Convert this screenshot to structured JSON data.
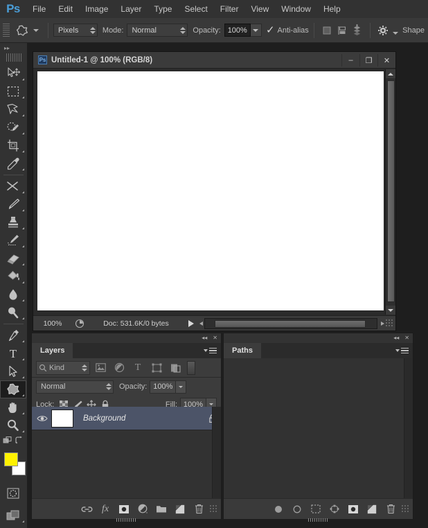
{
  "app": {
    "logo": "Ps",
    "accent_blue": "#4a9ed8",
    "chrome_bg": "#323232",
    "panel_bg": "#2e2e2e",
    "selected_layer_bg": "#4c5468",
    "foreground_color": "#FFF200",
    "background_color": "#FFFFFF"
  },
  "menubar": {
    "items": [
      {
        "label": "File"
      },
      {
        "label": "Edit"
      },
      {
        "label": "Image"
      },
      {
        "label": "Layer"
      },
      {
        "label": "Type"
      },
      {
        "label": "Select"
      },
      {
        "label": "Filter"
      },
      {
        "label": "View"
      },
      {
        "label": "Window"
      },
      {
        "label": "Help"
      }
    ]
  },
  "options_bar": {
    "tool_icon": "custom-shape-tool-icon",
    "draw_mode": {
      "label": "",
      "value": "Pixels"
    },
    "mode": {
      "label": "Mode:",
      "value": "Normal"
    },
    "opacity": {
      "label": "Opacity:",
      "value": "100%"
    },
    "antialias": {
      "label": "Anti-alias",
      "checked": true
    },
    "align_icon": "align-shape-icon",
    "arrange_icon": "arrange-shape-icon",
    "merge_icon": "merge-shapes-icon",
    "gear_icon": "gear-icon",
    "shape_label": "Shape"
  },
  "toolbar": {
    "collapse_label": "▸▸",
    "tools": [
      {
        "name": "move-tool",
        "glyph": "move"
      },
      {
        "name": "rectangular-marquee-tool",
        "glyph": "marquee"
      },
      {
        "name": "lasso-tool",
        "glyph": "lasso"
      },
      {
        "name": "quick-selection-tool",
        "glyph": "quickselect"
      },
      {
        "name": "crop-tool",
        "glyph": "crop"
      },
      {
        "name": "eyedropper-tool",
        "glyph": "eyedropper"
      },
      {
        "name": "spot-healing-brush-tool",
        "glyph": "heal"
      },
      {
        "name": "brush-tool",
        "glyph": "brush"
      },
      {
        "name": "clone-stamp-tool",
        "glyph": "stamp"
      },
      {
        "name": "history-brush-tool",
        "glyph": "historybrush"
      },
      {
        "name": "eraser-tool",
        "glyph": "eraser"
      },
      {
        "name": "gradient-tool",
        "glyph": "paintbucket"
      },
      {
        "name": "blur-tool",
        "glyph": "blur"
      },
      {
        "name": "dodge-tool",
        "glyph": "dodge"
      },
      {
        "name": "pen-tool",
        "glyph": "pen"
      },
      {
        "name": "type-tool",
        "glyph": "type"
      },
      {
        "name": "path-selection-tool",
        "glyph": "pathselect"
      },
      {
        "name": "custom-shape-tool",
        "glyph": "customshape",
        "selected": true
      },
      {
        "name": "hand-tool",
        "glyph": "hand"
      },
      {
        "name": "zoom-tool",
        "glyph": "zoom"
      }
    ],
    "edit_toolbar": {
      "name": "edit-toolbar-icon"
    },
    "swap_colors": {
      "name": "swap-colors-icon"
    },
    "default_colors": {
      "name": "default-colors-icon"
    },
    "quick_mask": {
      "name": "quick-mask-icon"
    },
    "screen_mode": {
      "name": "screen-mode-icon"
    }
  },
  "document": {
    "badge": "Ps",
    "title": "Untitled-1 @ 100% (RGB/8)",
    "window_buttons": [
      {
        "name": "minimize-button",
        "glyph": "–"
      },
      {
        "name": "maximize-button",
        "glyph": "❐"
      },
      {
        "name": "close-button",
        "glyph": "✕"
      }
    ],
    "status": {
      "zoom": "100%",
      "doc_info": "Doc: 531.6K/0 bytes",
      "proxy_icon": "proxy-preview-icon",
      "play_icon": "status-play-icon"
    }
  },
  "layers_panel": {
    "collapse_icon": "collapse-panel-icon",
    "close_icon": "close-panel-icon",
    "tabs": [
      {
        "label": "Layers",
        "active": true
      }
    ],
    "menu_icon": "panel-menu-icon",
    "filter": {
      "search_icon": "search-icon",
      "kind_label": "Kind",
      "icons": [
        {
          "name": "filter-pixel-layers-icon"
        },
        {
          "name": "filter-adjustment-layers-icon"
        },
        {
          "name": "filter-type-layers-icon"
        },
        {
          "name": "filter-shape-layers-icon"
        },
        {
          "name": "filter-smart-object-layers-icon"
        }
      ],
      "toggle_name": "filter-toggle-switch"
    },
    "blend_mode": {
      "value": "Normal"
    },
    "opacity": {
      "label": "Opacity:",
      "value": "100%"
    },
    "lock": {
      "label": "Lock:",
      "icons": [
        {
          "name": "lock-transparent-pixels-icon"
        },
        {
          "name": "lock-image-pixels-icon"
        },
        {
          "name": "lock-position-icon"
        },
        {
          "name": "lock-all-icon"
        }
      ]
    },
    "fill": {
      "label": "Fill:",
      "value": "100%"
    },
    "layers": [
      {
        "name": "Background",
        "visible": true,
        "locked": true,
        "selected": true,
        "thumbnail_color": "#FFFFFF"
      }
    ],
    "footer_buttons": [
      {
        "name": "link-layers-button",
        "glyph": "link"
      },
      {
        "name": "layer-style-button",
        "glyph": "fx"
      },
      {
        "name": "add-layer-mask-button",
        "glyph": "mask"
      },
      {
        "name": "new-adjustment-layer-button",
        "glyph": "adjust"
      },
      {
        "name": "new-group-button",
        "glyph": "folder"
      },
      {
        "name": "new-layer-button",
        "glyph": "newlayer"
      },
      {
        "name": "delete-layer-button",
        "glyph": "trash"
      }
    ]
  },
  "paths_panel": {
    "collapse_icon": "collapse-panel-icon",
    "close_icon": "close-panel-icon",
    "tabs": [
      {
        "label": "Paths",
        "active": true
      }
    ],
    "menu_icon": "panel-menu-icon",
    "paths": [],
    "footer_buttons": [
      {
        "name": "fill-path-button",
        "glyph": "fillpath"
      },
      {
        "name": "stroke-path-button",
        "glyph": "strokepath"
      },
      {
        "name": "load-path-as-selection-button",
        "glyph": "pathselection"
      },
      {
        "name": "make-work-path-button",
        "glyph": "makepath"
      },
      {
        "name": "add-layer-mask-button",
        "glyph": "mask"
      },
      {
        "name": "new-path-button",
        "glyph": "newlayer"
      },
      {
        "name": "delete-path-button",
        "glyph": "trash"
      }
    ]
  }
}
